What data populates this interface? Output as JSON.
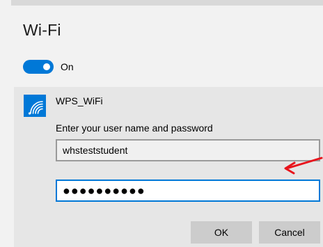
{
  "window": {
    "title": "Wi-Fi"
  },
  "wifi_toggle": {
    "state_label": "On",
    "is_on": true
  },
  "network": {
    "name": "WPS_WiFi",
    "icon": "wifi-signal-icon"
  },
  "credentials": {
    "prompt": "Enter your user name and password",
    "username_value": "whsteststudent",
    "password_masked": "●●●●●●●●●●"
  },
  "buttons": {
    "ok_label": "OK",
    "cancel_label": "Cancel"
  },
  "annotation": {
    "type": "arrow",
    "color": "#e8141c"
  },
  "colors": {
    "accent": "#0078d7",
    "panel": "#e6e6e6",
    "background": "#f2f2f2",
    "button": "#cccccc"
  }
}
